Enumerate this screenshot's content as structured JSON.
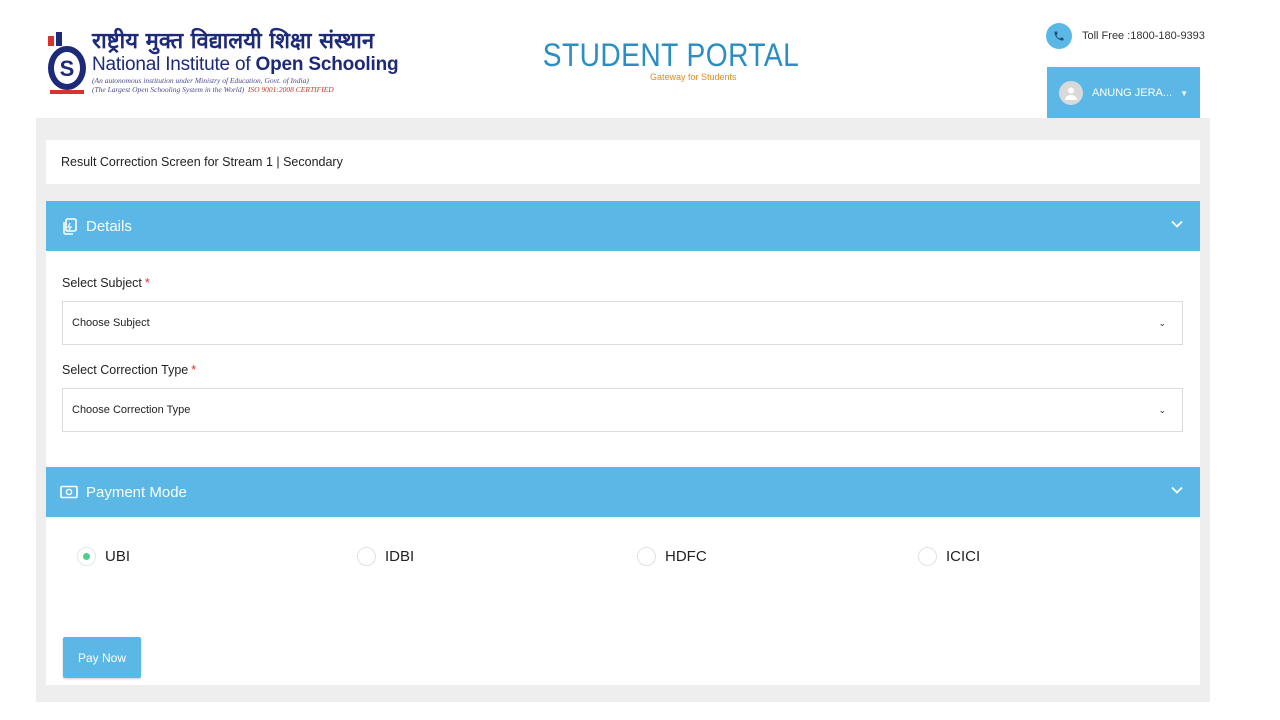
{
  "header": {
    "logo": {
      "hindi": "राष्ट्रीय मुक्त विद्यालयी शिक्षा संस्थान",
      "english_pre": "National Institute of ",
      "english_bold": "Open Schooling",
      "sub1": "(An autonomous institution under Ministry of Education, Govt. of India)",
      "sub2": "(The Largest Open Schooling System in the World)",
      "iso": "ISO 9001:2008 CERTIFIED"
    },
    "portal_title": "STUDENT PORTAL",
    "portal_subtitle": "Gateway for Students",
    "toll_free": "Toll Free :1800-180-9393",
    "user_name": "ANUNG JERA...",
    "phone_icon": "phone-icon",
    "avatar_icon": "user-avatar-icon"
  },
  "breadcrumb": "Result Correction Screen for Stream 1 | Secondary",
  "details": {
    "title": "Details",
    "subject_label": "Select Subject",
    "subject_value": "Choose Subject",
    "correction_label": "Select Correction Type",
    "correction_value": "Choose Correction Type",
    "required_mark": "*"
  },
  "payment": {
    "title": "Payment Mode",
    "options": [
      {
        "label": "UBI",
        "selected": true
      },
      {
        "label": "IDBI",
        "selected": false
      },
      {
        "label": "HDFC",
        "selected": false
      },
      {
        "label": "ICICI",
        "selected": false
      }
    ],
    "pay_button": "Pay Now"
  },
  "colors": {
    "accent": "#5bb8e6",
    "brand_blue": "#1d2a7a",
    "portal_blue": "#2a8ec4",
    "orange": "#e38b1a",
    "radio_selected": "#4cd08a",
    "required": "#d9342b"
  }
}
